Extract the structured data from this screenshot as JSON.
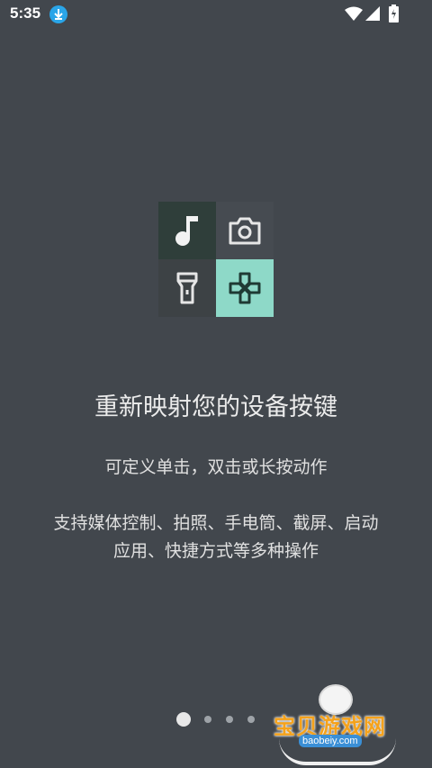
{
  "status_bar": {
    "time": "5:35",
    "icons": [
      "download-icon",
      "wifi-icon",
      "signal-icon",
      "battery-icon"
    ]
  },
  "feature_icons": [
    "music-note-icon",
    "camera-icon",
    "flashlight-icon",
    "gamepad-icon"
  ],
  "onboarding": {
    "title": "重新映射您的设备按键",
    "subtitle": "可定义单击，双击或长按动作",
    "description_line1": "支持媒体控制、拍照、手电筒、截屏、启动",
    "description_line2": "应用、快捷方式等多种操作"
  },
  "pager": {
    "page_count": 4,
    "current_page": 1
  },
  "watermark": {
    "brand": "宝贝游戏网",
    "url": "baobeiy.com"
  },
  "colors": {
    "background": "#42474d",
    "accent_tile": "#8ed9c8",
    "dark_tile": "#2f3e3a",
    "download_badge": "#2aa5e8"
  }
}
